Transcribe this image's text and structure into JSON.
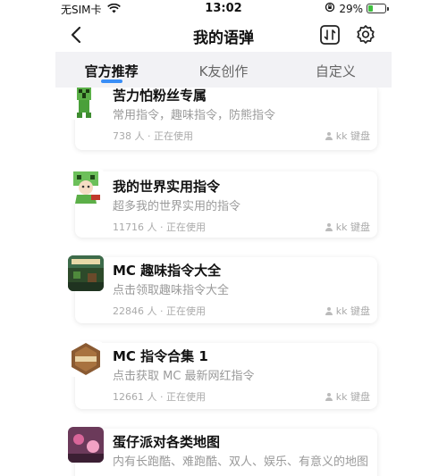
{
  "status_bar": {
    "carrier": "无SIM卡",
    "time": "13:02",
    "battery_text": "29%",
    "battery_level": 0.29,
    "icons": [
      "wifi-icon",
      "rotation-lock-icon",
      "battery-icon"
    ]
  },
  "nav": {
    "title": "我的语弹",
    "icons": [
      "back-chevron-icon",
      "sort-icon",
      "settings-icon"
    ]
  },
  "tabs": [
    {
      "label": "官方推荐",
      "active": true
    },
    {
      "label": "K友创作",
      "active": false
    },
    {
      "label": "自定义",
      "active": false
    }
  ],
  "cards": [
    {
      "title": "苦力怕粉丝专属",
      "desc": "常用指令，趣味指令，防熊指令",
      "users": "738 人 · 正在使用",
      "source": "kk 键盘",
      "icon": "creeper-icon"
    },
    {
      "title": "我的世界实用指令",
      "desc": "超多我的世界实用的指令",
      "users": "11716 人 · 正在使用",
      "source": "kk 键盘",
      "icon": "creeper-girl-icon"
    },
    {
      "title": "MC 趣味指令大全",
      "desc": "点击领取趣味指令大全",
      "users": "22846 人 · 正在使用",
      "source": "kk 键盘",
      "icon": "minecraft-world-icon"
    },
    {
      "title": "MC 指令合集 1",
      "desc": "点击获取 MC 最新网红指令",
      "users": "12661 人 · 正在使用",
      "source": "kk 键盘",
      "icon": "minecraft-badge-icon"
    },
    {
      "title": "蛋仔派对各类地图",
      "desc": "内有长跑酷、难跑酷、双人、娱乐、有意义的地图",
      "users": "",
      "source": "",
      "icon": "eggy-party-icon"
    }
  ]
}
